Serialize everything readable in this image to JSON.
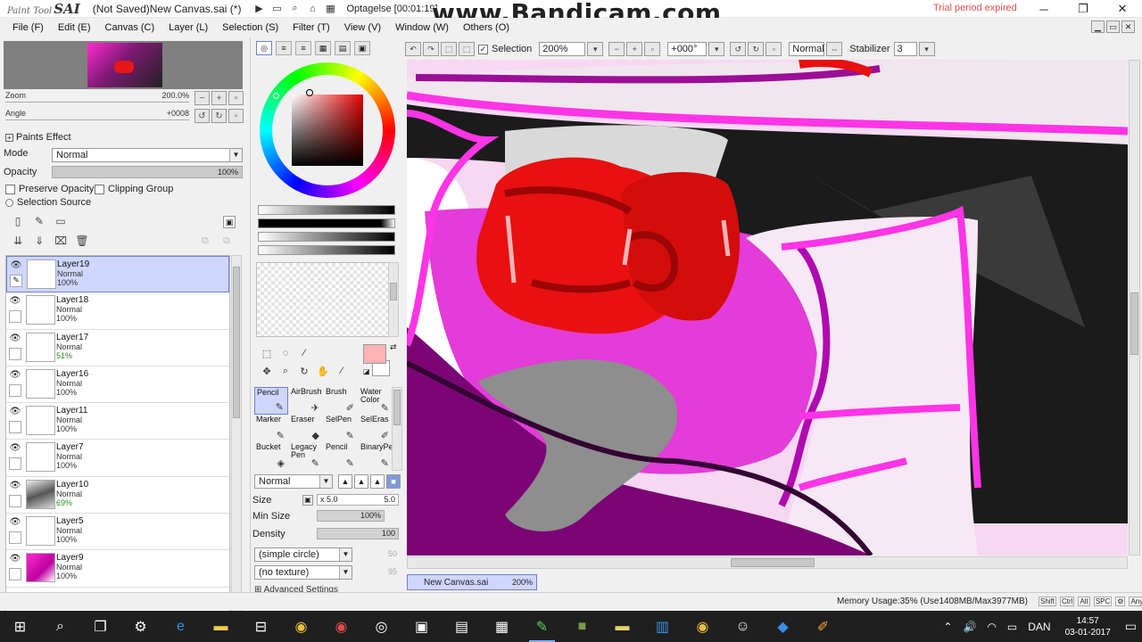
{
  "app": {
    "logo_small": "Paint Tool",
    "logo_big": "SAI",
    "window_title": "(Not Saved)New Canvas.sai (*)",
    "recorder_title": "Optagelse [00:01:19]",
    "watermark": "www.Bandicam.com",
    "trial_text": "Trial period expired"
  },
  "menu": [
    "File (F)",
    "Edit (E)",
    "Canvas (C)",
    "Layer (L)",
    "Selection (S)",
    "Filter (T)",
    "View (V)",
    "Window (W)",
    "Others (O)"
  ],
  "navigator": {
    "zoom_label": "Zoom",
    "zoom_value": "200.0%",
    "angle_label": "Angle",
    "angle_value": "+0008"
  },
  "paints_effect": {
    "title": "Paints Effect",
    "mode_label": "Mode",
    "mode_value": "Normal",
    "opacity_label": "Opacity",
    "opacity_value": "100%",
    "preserve_opacity": "Preserve Opacity",
    "clipping_group": "Clipping Group",
    "selection_source": "Selection Source"
  },
  "layers": [
    {
      "name": "Layer19",
      "mode": "Normal",
      "opacity": "100%",
      "active": true
    },
    {
      "name": "Layer18",
      "mode": "Normal",
      "opacity": "100%"
    },
    {
      "name": "Layer17",
      "mode": "Normal",
      "opacity": "51%"
    },
    {
      "name": "Layer16",
      "mode": "Normal",
      "opacity": "100%"
    },
    {
      "name": "Layer11",
      "mode": "Normal",
      "opacity": "100%"
    },
    {
      "name": "Layer7",
      "mode": "Normal",
      "opacity": "100%"
    },
    {
      "name": "Layer10",
      "mode": "Normal",
      "opacity": "69%"
    },
    {
      "name": "Layer5",
      "mode": "Normal",
      "opacity": "100%"
    },
    {
      "name": "Layer9",
      "mode": "Normal",
      "opacity": "100%"
    }
  ],
  "tools": {
    "brushes": [
      {
        "label": "Pencil",
        "glyph": "✎",
        "active": true
      },
      {
        "label": "AirBrush",
        "glyph": "✈"
      },
      {
        "label": "Brush",
        "glyph": "✐"
      },
      {
        "label": "Water Color",
        "glyph": "✎"
      },
      {
        "label": "Marker",
        "glyph": "✎"
      },
      {
        "label": "Eraser",
        "glyph": "◆"
      },
      {
        "label": "SelPen",
        "glyph": "✎"
      },
      {
        "label": "SelEras",
        "glyph": "✐"
      },
      {
        "label": "Bucket",
        "glyph": "◈"
      },
      {
        "label": "Legacy Pen",
        "glyph": "✎"
      },
      {
        "label": "Pencil",
        "glyph": "✎"
      },
      {
        "label": "BinaryPe",
        "glyph": "✎"
      }
    ],
    "blend_mode": "Normal",
    "size_label": "Size",
    "size_mult": "x 5.0",
    "size_value": "5.0",
    "min_size_label": "Min Size",
    "min_size_value": "100%",
    "density_label": "Density",
    "density_value": "100",
    "shape_value": "(simple circle)",
    "shape_num": "50",
    "texture_value": "(no texture)",
    "texture_num": "95",
    "advanced_settings": "Advanced Settings",
    "fg_color": "#ffb3b3"
  },
  "canvas_toolbar": {
    "selection_label": "Selection",
    "zoom": "200%",
    "angle": "+000°",
    "blend": "Normal",
    "stabilizer_label": "Stabilizer",
    "stabilizer_value": "3"
  },
  "canvas_tab": {
    "name": "New Canvas.sai",
    "zoom": "200%"
  },
  "status": {
    "memory": "Memory Usage:35% (Use1408MB/Max3977MB)",
    "keys": [
      "Shift",
      "Ctrl",
      "Alt",
      "SPC",
      "⚙",
      "Any"
    ]
  },
  "taskbar": {
    "language": "DAN",
    "time": "14:57",
    "date": "03-01-2017"
  },
  "colors": {
    "accent": "#6f7fd8",
    "active_row": "#cfd7ff",
    "pink": "#ff34e6",
    "red": "#e81010",
    "purple": "#9b0f96"
  }
}
